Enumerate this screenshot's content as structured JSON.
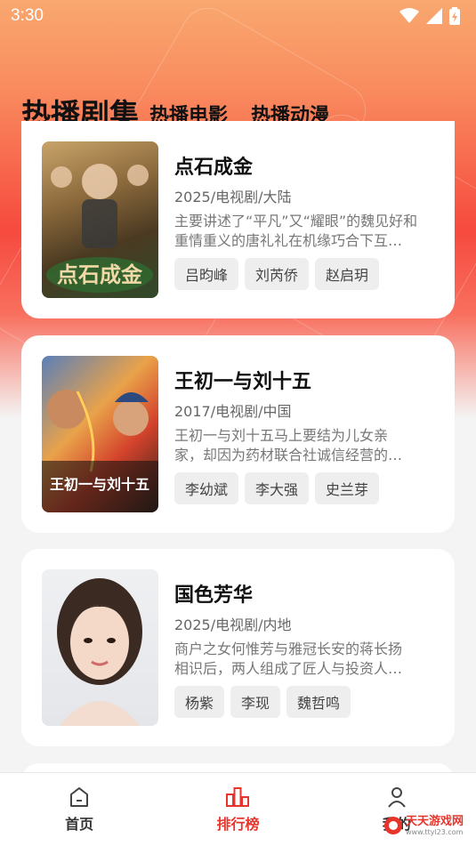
{
  "status_bar": {
    "time": "3:30"
  },
  "tabs": [
    {
      "label": "热播剧集",
      "active": true
    },
    {
      "label": "热播电影",
      "active": false
    },
    {
      "label": "热播动漫",
      "active": false
    }
  ],
  "items": [
    {
      "title": "点石成金",
      "meta": "2025/电视剧/大陆",
      "desc_line1": "主要讲述了“平凡”又“耀眼”的魏见好和",
      "desc_line2": "重情重义的唐礼礼在机缘巧合下互…",
      "tags": [
        "吕昀峰",
        "刘芮侨",
        "赵启玥"
      ],
      "poster_text": "点石成金"
    },
    {
      "title": "王初一与刘十五",
      "meta": "2017/电视剧/中国",
      "desc_line1": "王初一与刘十五马上要结为儿女亲",
      "desc_line2": "家，却因为药材联合社诚信经营的…",
      "tags": [
        "李幼斌",
        "李大强",
        "史兰芽"
      ],
      "poster_text": "王初一与刘十五"
    },
    {
      "title": "国色芳华",
      "meta": "2025/电视剧/内地",
      "desc_line1": "商户之女何惟芳与雅冠长安的蒋长扬",
      "desc_line2": "相识后，两人组成了匠人与投资人…",
      "tags": [
        "杨紫",
        "李现",
        "魏哲鸣"
      ],
      "poster_text": ""
    }
  ],
  "bottom_nav": [
    {
      "label": "首页",
      "icon": "home-icon",
      "active": false
    },
    {
      "label": "排行榜",
      "icon": "chart-icon",
      "active": true
    },
    {
      "label": "我的",
      "icon": "user-icon",
      "active": false
    }
  ],
  "watermark": {
    "text": "天天游戏网",
    "url": "www.ttyl23.com"
  },
  "colors": {
    "accent": "#e8352c",
    "gradient_top": "#f9a86f",
    "gradient_mid": "#f64a3e"
  }
}
